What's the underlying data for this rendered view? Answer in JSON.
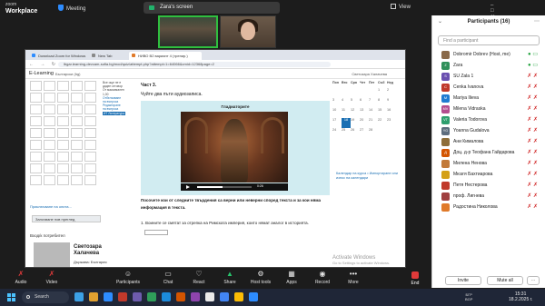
{
  "zoom": {
    "logo_line1": "zoom",
    "logo_line2": "Workplace",
    "meeting_label": "Meeting",
    "screen_share_label": "Zara's screen",
    "view_label": "View",
    "thumbnails": [
      {
        "label": ""
      },
      {
        "label": ""
      }
    ]
  },
  "browser": {
    "tabs": [
      {
        "label": "Download Zoom for Windows",
        "color": "#2d8cff"
      },
      {
        "label": "New Tab",
        "color": "#888888"
      },
      {
        "label": "НИВО В2 вариант 4 (тренир.)",
        "color": "#e07a2a"
      }
    ],
    "url": "lbgar.learning-devcam-sofia.bg/mod/quiz/attempt.php?attempt=1=64066&cmid=12368page=2",
    "site_name": "E-Learning",
    "site_lang": "Български (bg)",
    "user_header": "Светозара Халачева",
    "left_note": "Приключване на опита...",
    "left_button": "Започване нов преглед",
    "left_section": "Вход/к потребител",
    "user_name_line1": "Светозара",
    "user_name_line2": "Халачева",
    "user_country": "Държава: България",
    "side_mini": [
      "Все още не е",
      "даден отговор",
      "От максимален",
      "1,00",
      "Отбелязване",
      "на въпроса",
      "Редактиране",
      "на въпроса"
    ],
    "side_badge": "ИТ Литература"
  },
  "quiz": {
    "part_title": "Част 3.",
    "instruction": "Чуйте два пъти аудиозаписа.",
    "media_title": "Гладиаторите",
    "audio_time": "0:26",
    "question_text": "Посочете кои от следните твърдения са верни или неверни според текста и за кои няма информация в текста.",
    "question_1": "1. Воините се смятат за отрепка на Римската империя, които нямат аналог в историята."
  },
  "calendar": {
    "days": [
      "Пон",
      "Вто",
      "Сря",
      "Чет",
      "Пет",
      "Съб",
      "Нед"
    ],
    "rows": [
      [
        "",
        "",
        "",
        "",
        "",
        "1",
        "2"
      ],
      [
        "3",
        "4",
        "5",
        "6",
        "7",
        "8",
        "9"
      ],
      [
        "10",
        "11",
        "12",
        "13",
        "14",
        "15",
        "16"
      ],
      [
        "17",
        "18",
        "19",
        "20",
        "21",
        "22",
        "23"
      ],
      [
        "24",
        "25",
        "26",
        "27",
        "28",
        "",
        ""
      ]
    ],
    "today": "18",
    "link_text": "Календар на курса • Импортиране или износ на календари"
  },
  "activate": {
    "line1": "Activate Windows",
    "line2": "Go to Settings to activate Windows."
  },
  "participants": {
    "title": "Participants (16)",
    "search_placeholder": "Find a participant",
    "list": [
      {
        "initials": "",
        "name": "Dobromir Dobrev (Host, me)",
        "color": "#8a6a4a",
        "status": "on"
      },
      {
        "initials": "Z",
        "name": "Zara",
        "color": "#2f8f5a",
        "status": "on"
      },
      {
        "initials": "S",
        "name": "SU Zala 1",
        "color": "#6a4fb0",
        "status": "off"
      },
      {
        "initials": "C",
        "name": "Cenka Ivanova",
        "color": "#c0392b",
        "status": "off"
      },
      {
        "initials": "M",
        "name": "Mariya Ilieva",
        "color": "#1f7bd1",
        "status": "off"
      },
      {
        "initials": "MV",
        "name": "Milena Vidraska",
        "color": "#b34d8f",
        "status": "off"
      },
      {
        "initials": "VT",
        "name": "Valeria Todorova",
        "color": "#2e9e6e",
        "status": "off"
      },
      {
        "initials": "YG",
        "name": "Yoanna Gudalova",
        "color": "#5d6d7e",
        "status": "off"
      },
      {
        "initials": "",
        "name": "Ани Кималова",
        "color": "#8e6e3a",
        "status": "off"
      },
      {
        "initials": "Д",
        "name": "Доц. д-р Теофана Гайдарова",
        "color": "#d35400",
        "status": "off"
      },
      {
        "initials": "",
        "name": "Милена Ненова",
        "color": "#c27a3a",
        "status": "off"
      },
      {
        "initials": "",
        "name": "Мюзгя Бахтиарова",
        "color": "#d4a017",
        "status": "off"
      },
      {
        "initials": "",
        "name": "Петя Нестерова",
        "color": "#c0392b",
        "status": "off"
      },
      {
        "initials": "",
        "name": "проф. Лигнева",
        "color": "#a04040",
        "status": "off"
      },
      {
        "initials": "",
        "name": "Радостина Николова",
        "color": "#e07a2a",
        "status": "off"
      }
    ],
    "invite_label": "Invite",
    "mute_all_label": "Mute all"
  },
  "toolbar": {
    "items": [
      {
        "label": "Audio",
        "glyph": "✗",
        "tone": "red"
      },
      {
        "label": "Video",
        "glyph": "✗",
        "tone": "red"
      },
      {
        "label": "Participants",
        "glyph": "☺",
        "tone": "white"
      },
      {
        "label": "Chat",
        "glyph": "▭",
        "tone": "white"
      },
      {
        "label": "React",
        "glyph": "♡",
        "tone": "white"
      },
      {
        "label": "Share",
        "glyph": "▲",
        "tone": "green"
      },
      {
        "label": "Host tools",
        "glyph": "⚙",
        "tone": "white"
      },
      {
        "label": "Apps",
        "glyph": "▦",
        "tone": "white"
      },
      {
        "label": "Record",
        "glyph": "◉",
        "tone": "white"
      },
      {
        "label": "More",
        "glyph": "•••",
        "tone": "white"
      }
    ],
    "end_label": "End"
  },
  "taskbar": {
    "search_label": "Search",
    "tray_line1": "БГР",
    "tray_line2": "BGP",
    "time": "15:31",
    "date": "18.2.2025 г.",
    "app_colors": [
      "#3ca0e6",
      "#e0a030",
      "#2d8cff",
      "#c0392b",
      "#6d5cae",
      "#2f9e5a",
      "#1c8adb",
      "#d35400",
      "#8e44ad",
      "#eaeaea",
      "#4285f4",
      "#fbbc05",
      "#2d8cff"
    ]
  }
}
